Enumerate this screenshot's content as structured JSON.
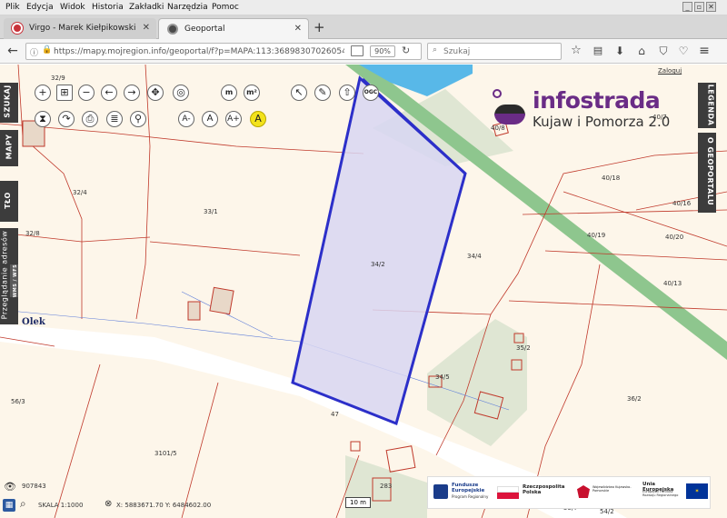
{
  "browser": {
    "menu": [
      "Plik",
      "Edycja",
      "Widok",
      "Historia",
      "Zakładki",
      "Narzędzia",
      "Pomoc"
    ],
    "tabs": [
      {
        "label": "Virgo - Marek Kiełpikowski",
        "active": false
      },
      {
        "label": "Geoportal",
        "active": true
      }
    ],
    "url": "https://mapy.mojregion.info/geoportal/f?p=MAPA:113:3689830702605493::::P1",
    "zoom": "90%",
    "search_placeholder": "Szukaj"
  },
  "map": {
    "login": "Zaloguj",
    "brand_name": "infostrada",
    "brand_sub": "Kujaw i Pomorza 2.0",
    "measure_tools": {
      "length": "m",
      "area": "m²"
    },
    "ogc": "OGC",
    "text_size_buttons": [
      "A-",
      "A",
      "A+",
      "A"
    ],
    "left_tabs": [
      "SZUKAJ",
      "MAPY",
      "TŁO",
      "Przeglądanie adresów",
      "WMS / WFS"
    ],
    "right_tabs": [
      "LEGENDA",
      "O GEOPORTALU"
    ],
    "place_name": "Olek",
    "parcels": [
      "32/9",
      "32/4",
      "33/1",
      "32/8",
      "34/2",
      "34/4",
      "40/8",
      "40/7",
      "40/18",
      "40/16",
      "40/19",
      "40/20",
      "40/13",
      "35/2",
      "34/5",
      "36/2",
      "56/3",
      "47",
      "3101/5",
      "283",
      "55/7",
      "54/2"
    ],
    "scale_bar": "10 m",
    "visits": "907843",
    "scale": "SKALA 1:1000",
    "coords": "X: 5883671.70  Y: 6484602.00",
    "eu_banner": {
      "fundusze": "Fundusze Europejskie",
      "fundusze_sub": "Program Regionalny",
      "rp": "Rzeczpospolita Polska",
      "woj": "Województwo Kujawsko-Pomorskie",
      "ue": "Unia Europejska",
      "ue_sub": "Europejski Fundusz Rozwoju Regionalnego"
    },
    "colors": {
      "parcel_border": "#c0392b",
      "selection": "#2c2fc9",
      "brand_purple": "#6a2c86",
      "green_strip": "#7dbb7d"
    }
  }
}
